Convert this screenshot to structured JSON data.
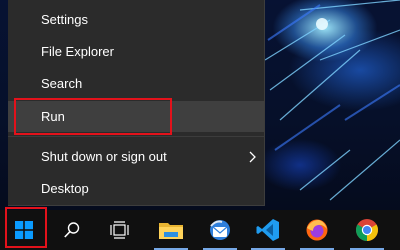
{
  "menu": {
    "items": [
      {
        "label": "Settings"
      },
      {
        "label": "File Explorer"
      },
      {
        "label": "Search"
      },
      {
        "label": "Run"
      },
      {
        "label": "Shut down or sign out"
      },
      {
        "label": "Desktop"
      }
    ],
    "hovered_item": "Run",
    "highlight_color": "#e3121b"
  },
  "taskbar": {
    "icons": [
      {
        "name": "windows-start-icon"
      },
      {
        "name": "search-icon"
      },
      {
        "name": "task-view-icon"
      },
      {
        "name": "file-explorer-icon"
      },
      {
        "name": "thunderbird-icon"
      },
      {
        "name": "vscode-icon"
      },
      {
        "name": "firefox-icon"
      },
      {
        "name": "chrome-icon"
      }
    ],
    "accent_color": "#76a8e6"
  }
}
